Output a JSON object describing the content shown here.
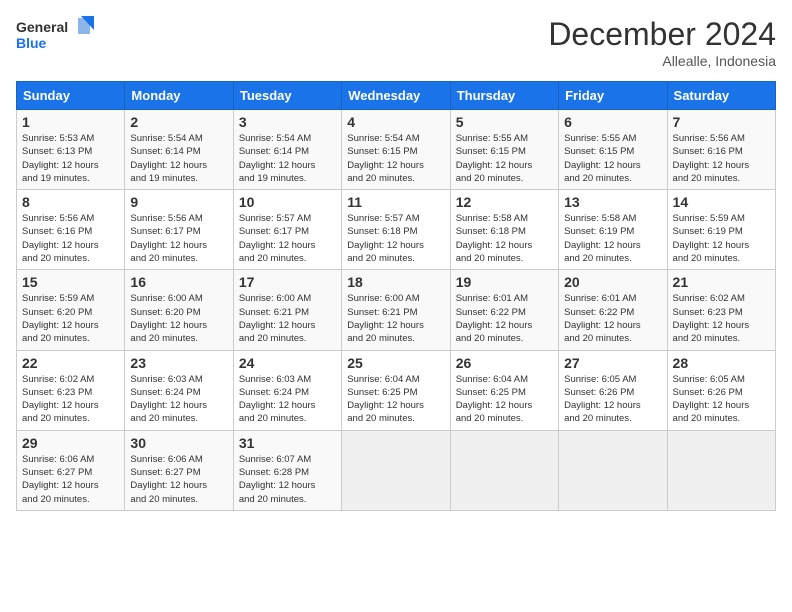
{
  "header": {
    "logo_line1": "General",
    "logo_line2": "Blue",
    "month": "December 2024",
    "location": "Allealle, Indonesia"
  },
  "days_of_week": [
    "Sunday",
    "Monday",
    "Tuesday",
    "Wednesday",
    "Thursday",
    "Friday",
    "Saturday"
  ],
  "weeks": [
    [
      {
        "day": "1",
        "info": "Sunrise: 5:53 AM\nSunset: 6:13 PM\nDaylight: 12 hours\nand 19 minutes."
      },
      {
        "day": "2",
        "info": "Sunrise: 5:54 AM\nSunset: 6:14 PM\nDaylight: 12 hours\nand 19 minutes."
      },
      {
        "day": "3",
        "info": "Sunrise: 5:54 AM\nSunset: 6:14 PM\nDaylight: 12 hours\nand 19 minutes."
      },
      {
        "day": "4",
        "info": "Sunrise: 5:54 AM\nSunset: 6:15 PM\nDaylight: 12 hours\nand 20 minutes."
      },
      {
        "day": "5",
        "info": "Sunrise: 5:55 AM\nSunset: 6:15 PM\nDaylight: 12 hours\nand 20 minutes."
      },
      {
        "day": "6",
        "info": "Sunrise: 5:55 AM\nSunset: 6:15 PM\nDaylight: 12 hours\nand 20 minutes."
      },
      {
        "day": "7",
        "info": "Sunrise: 5:56 AM\nSunset: 6:16 PM\nDaylight: 12 hours\nand 20 minutes."
      }
    ],
    [
      {
        "day": "8",
        "info": "Sunrise: 5:56 AM\nSunset: 6:16 PM\nDaylight: 12 hours\nand 20 minutes."
      },
      {
        "day": "9",
        "info": "Sunrise: 5:56 AM\nSunset: 6:17 PM\nDaylight: 12 hours\nand 20 minutes."
      },
      {
        "day": "10",
        "info": "Sunrise: 5:57 AM\nSunset: 6:17 PM\nDaylight: 12 hours\nand 20 minutes."
      },
      {
        "day": "11",
        "info": "Sunrise: 5:57 AM\nSunset: 6:18 PM\nDaylight: 12 hours\nand 20 minutes."
      },
      {
        "day": "12",
        "info": "Sunrise: 5:58 AM\nSunset: 6:18 PM\nDaylight: 12 hours\nand 20 minutes."
      },
      {
        "day": "13",
        "info": "Sunrise: 5:58 AM\nSunset: 6:19 PM\nDaylight: 12 hours\nand 20 minutes."
      },
      {
        "day": "14",
        "info": "Sunrise: 5:59 AM\nSunset: 6:19 PM\nDaylight: 12 hours\nand 20 minutes."
      }
    ],
    [
      {
        "day": "15",
        "info": "Sunrise: 5:59 AM\nSunset: 6:20 PM\nDaylight: 12 hours\nand 20 minutes."
      },
      {
        "day": "16",
        "info": "Sunrise: 6:00 AM\nSunset: 6:20 PM\nDaylight: 12 hours\nand 20 minutes."
      },
      {
        "day": "17",
        "info": "Sunrise: 6:00 AM\nSunset: 6:21 PM\nDaylight: 12 hours\nand 20 minutes."
      },
      {
        "day": "18",
        "info": "Sunrise: 6:00 AM\nSunset: 6:21 PM\nDaylight: 12 hours\nand 20 minutes."
      },
      {
        "day": "19",
        "info": "Sunrise: 6:01 AM\nSunset: 6:22 PM\nDaylight: 12 hours\nand 20 minutes."
      },
      {
        "day": "20",
        "info": "Sunrise: 6:01 AM\nSunset: 6:22 PM\nDaylight: 12 hours\nand 20 minutes."
      },
      {
        "day": "21",
        "info": "Sunrise: 6:02 AM\nSunset: 6:23 PM\nDaylight: 12 hours\nand 20 minutes."
      }
    ],
    [
      {
        "day": "22",
        "info": "Sunrise: 6:02 AM\nSunset: 6:23 PM\nDaylight: 12 hours\nand 20 minutes."
      },
      {
        "day": "23",
        "info": "Sunrise: 6:03 AM\nSunset: 6:24 PM\nDaylight: 12 hours\nand 20 minutes."
      },
      {
        "day": "24",
        "info": "Sunrise: 6:03 AM\nSunset: 6:24 PM\nDaylight: 12 hours\nand 20 minutes."
      },
      {
        "day": "25",
        "info": "Sunrise: 6:04 AM\nSunset: 6:25 PM\nDaylight: 12 hours\nand 20 minutes."
      },
      {
        "day": "26",
        "info": "Sunrise: 6:04 AM\nSunset: 6:25 PM\nDaylight: 12 hours\nand 20 minutes."
      },
      {
        "day": "27",
        "info": "Sunrise: 6:05 AM\nSunset: 6:26 PM\nDaylight: 12 hours\nand 20 minutes."
      },
      {
        "day": "28",
        "info": "Sunrise: 6:05 AM\nSunset: 6:26 PM\nDaylight: 12 hours\nand 20 minutes."
      }
    ],
    [
      {
        "day": "29",
        "info": "Sunrise: 6:06 AM\nSunset: 6:27 PM\nDaylight: 12 hours\nand 20 minutes."
      },
      {
        "day": "30",
        "info": "Sunrise: 6:06 AM\nSunset: 6:27 PM\nDaylight: 12 hours\nand 20 minutes."
      },
      {
        "day": "31",
        "info": "Sunrise: 6:07 AM\nSunset: 6:28 PM\nDaylight: 12 hours\nand 20 minutes."
      },
      {
        "day": "",
        "info": ""
      },
      {
        "day": "",
        "info": ""
      },
      {
        "day": "",
        "info": ""
      },
      {
        "day": "",
        "info": ""
      }
    ]
  ]
}
